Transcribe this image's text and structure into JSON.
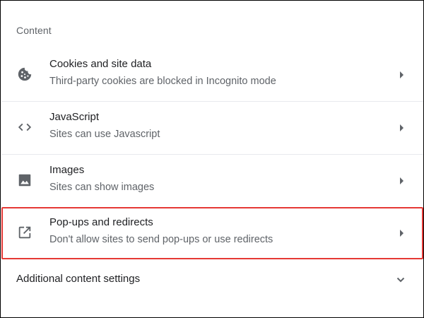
{
  "section": {
    "title": "Content"
  },
  "rows": [
    {
      "title": "Cookies and site data",
      "subtitle": "Third-party cookies are blocked in Incognito mode",
      "icon": "cookie-icon"
    },
    {
      "title": "JavaScript",
      "subtitle": "Sites can use Javascript",
      "icon": "code-brackets-icon"
    },
    {
      "title": "Images",
      "subtitle": "Sites can show images",
      "icon": "image-icon"
    },
    {
      "title": "Pop-ups and redirects",
      "subtitle": "Don't allow sites to send pop-ups or use redirects",
      "icon": "open-in-new-icon"
    }
  ],
  "additional": {
    "label": "Additional content settings",
    "icon": "chevron-down-icon"
  },
  "colors": {
    "text_primary": "#202124",
    "text_secondary": "#5f6368",
    "icon": "#5f6368",
    "divider": "#e8eaed",
    "highlight_border": "#e53935"
  }
}
